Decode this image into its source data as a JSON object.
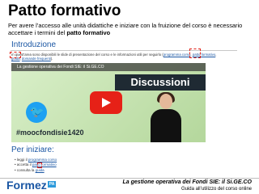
{
  "slide": {
    "title": "Patto formativo",
    "intro_text": "Per avere l’accesso alle unità didattiche e iniziare con la fruizione del corso è necessario accettare i termini del",
    "intro_bold": "patto formativo"
  },
  "screen": {
    "section1_title": "Introduzione",
    "desc_text": "In quest’area sono disponibili le slide di presentazione del corso e le informazioni utili per seguirlo (",
    "desc_link1": "programma corso",
    "desc_sep": ", ",
    "desc_link2": "patto formativo",
    "desc_text2": ", ",
    "desc_link3": "guida",
    "desc_text3": ", ",
    "desc_link4": "domande frequenti",
    "desc_end": ").",
    "video": {
      "caption": "La gestione operativa dei Fondi SIE: il Si.GE.CO",
      "overlay_title": "Discussioni",
      "hashtag": "#moocfondisie1420",
      "accent_color": "#e62117",
      "twitter_color": "#1da1f2"
    },
    "section2_title": "Per iniziare:",
    "bullets": [
      {
        "text": "leggi il ",
        "link": "programma corso"
      },
      {
        "text": "accetta il ",
        "link": "patto formativo"
      },
      {
        "text": "consulta la ",
        "link": "guida"
      }
    ]
  },
  "footer": {
    "logo_text": "Formez",
    "logo_badge": "PA",
    "title": "La gestione operativa dei Fondi SIE: il Si.GE.CO",
    "subtitle": "Guida all’utilizzo del corso online"
  }
}
